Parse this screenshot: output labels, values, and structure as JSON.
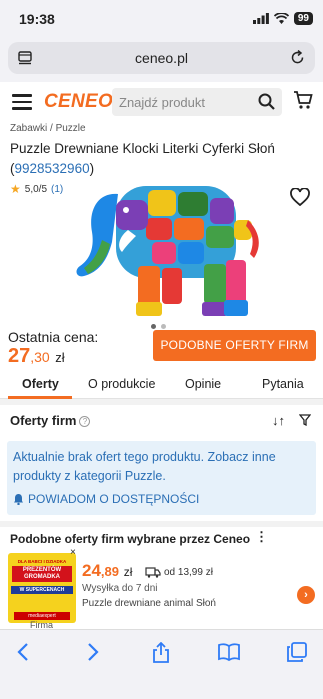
{
  "status": {
    "time": "19:38",
    "battery": "99"
  },
  "browser": {
    "url": "ceneo.pl"
  },
  "header": {
    "logo": "CENEO",
    "search_placeholder": "Znajdź produkt"
  },
  "product": {
    "breadcrumb": "Zabawki / Puzzle",
    "title": "Puzzle Drewniane Klocki Literki Cyferki Słoń",
    "id_open": "(",
    "id": "9928532960",
    "id_close": ")",
    "rating_star": "★",
    "rating": "5,0/5",
    "rating_count": "(1)",
    "last_price_label": "Ostatnia cena:",
    "last_price_int": "27",
    "last_price_dec": ",30",
    "currency": "zł",
    "similar_offers_button": "PODOBNE OFERTY FIRM"
  },
  "tabs": [
    {
      "label": "Oferty"
    },
    {
      "label": "O produkcie"
    },
    {
      "label": "Opinie"
    },
    {
      "label": "Pytania"
    }
  ],
  "offers": {
    "title": "Oferty firm",
    "info_symbol": "?",
    "sort_symbol": "↓↑",
    "notice": "Aktualnie brak ofert tego produktu. Zobacz inne produkty z kategorii Puzzle.",
    "notify_label": "POWIADOM O DOSTĘPNOŚCI"
  },
  "similar": {
    "heading": "Podobne oferty firm wybrane przez Ceneo",
    "ad": {
      "line1": "DLA BABCI I DZIADKA",
      "line2": "PREZENTÓW GROMADKA",
      "line3": "W SUPERCENACH",
      "line4": "mediaexpert",
      "close": "×",
      "caption": "Firma"
    },
    "offer": {
      "price_int": "24",
      "price_dec": ",89",
      "currency": "zł",
      "shipping": "od 13,99 zł",
      "delivery": "Wysyłka do 7 dni",
      "name": "Puzzle drewniane animal Słoń",
      "arrow": "›"
    }
  },
  "colors": {
    "accent": "#f36c21",
    "link": "#2b6fb5",
    "notice_bg": "#e6f1fa"
  }
}
